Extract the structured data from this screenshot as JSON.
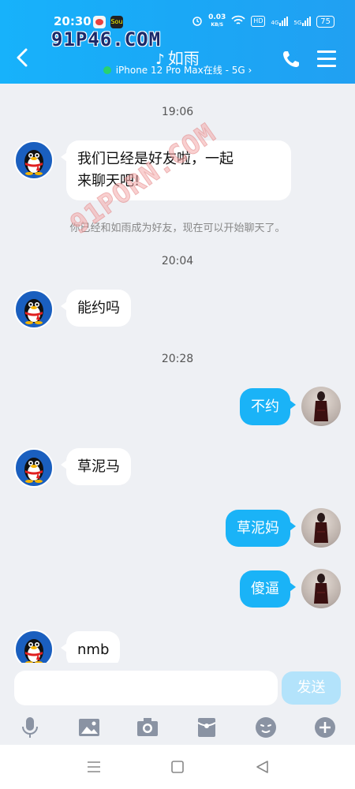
{
  "status_bar": {
    "time": "20:30",
    "app1_icon": "weibo-icon",
    "app2_label": "Sou",
    "speed_value": "0.03",
    "speed_unit": "KB/S",
    "hd_label": "HD",
    "net1": "4G",
    "net2": "5G",
    "battery": "75"
  },
  "watermark": "91P46.COM",
  "chat_watermark": "91PORN.COM",
  "header": {
    "contact_name": "如雨",
    "status_text": "iPhone 12 Pro Max在线 - 5G",
    "status_chevron": "›",
    "ear_glyph": "♪"
  },
  "messages": {
    "time1": "19:06",
    "msg1": "我们已经是好友啦，一起\n来聊天吧!",
    "system_note": "你已经和如雨成为好友，现在可以开始聊天了。",
    "time2": "20:04",
    "msg2": "能约吗",
    "time3": "20:28",
    "msg3": "不约",
    "msg4": "草泥马",
    "msg5": "草泥妈",
    "msg6": "傻逼",
    "msg7": "nmb"
  },
  "input": {
    "value": "",
    "send_label": "发送"
  },
  "colors": {
    "header_blue": "#1aa8f6",
    "bubble_blue": "#1ab3f7",
    "send_disabled": "#b3e3fb",
    "online_green": "#29d16f"
  }
}
